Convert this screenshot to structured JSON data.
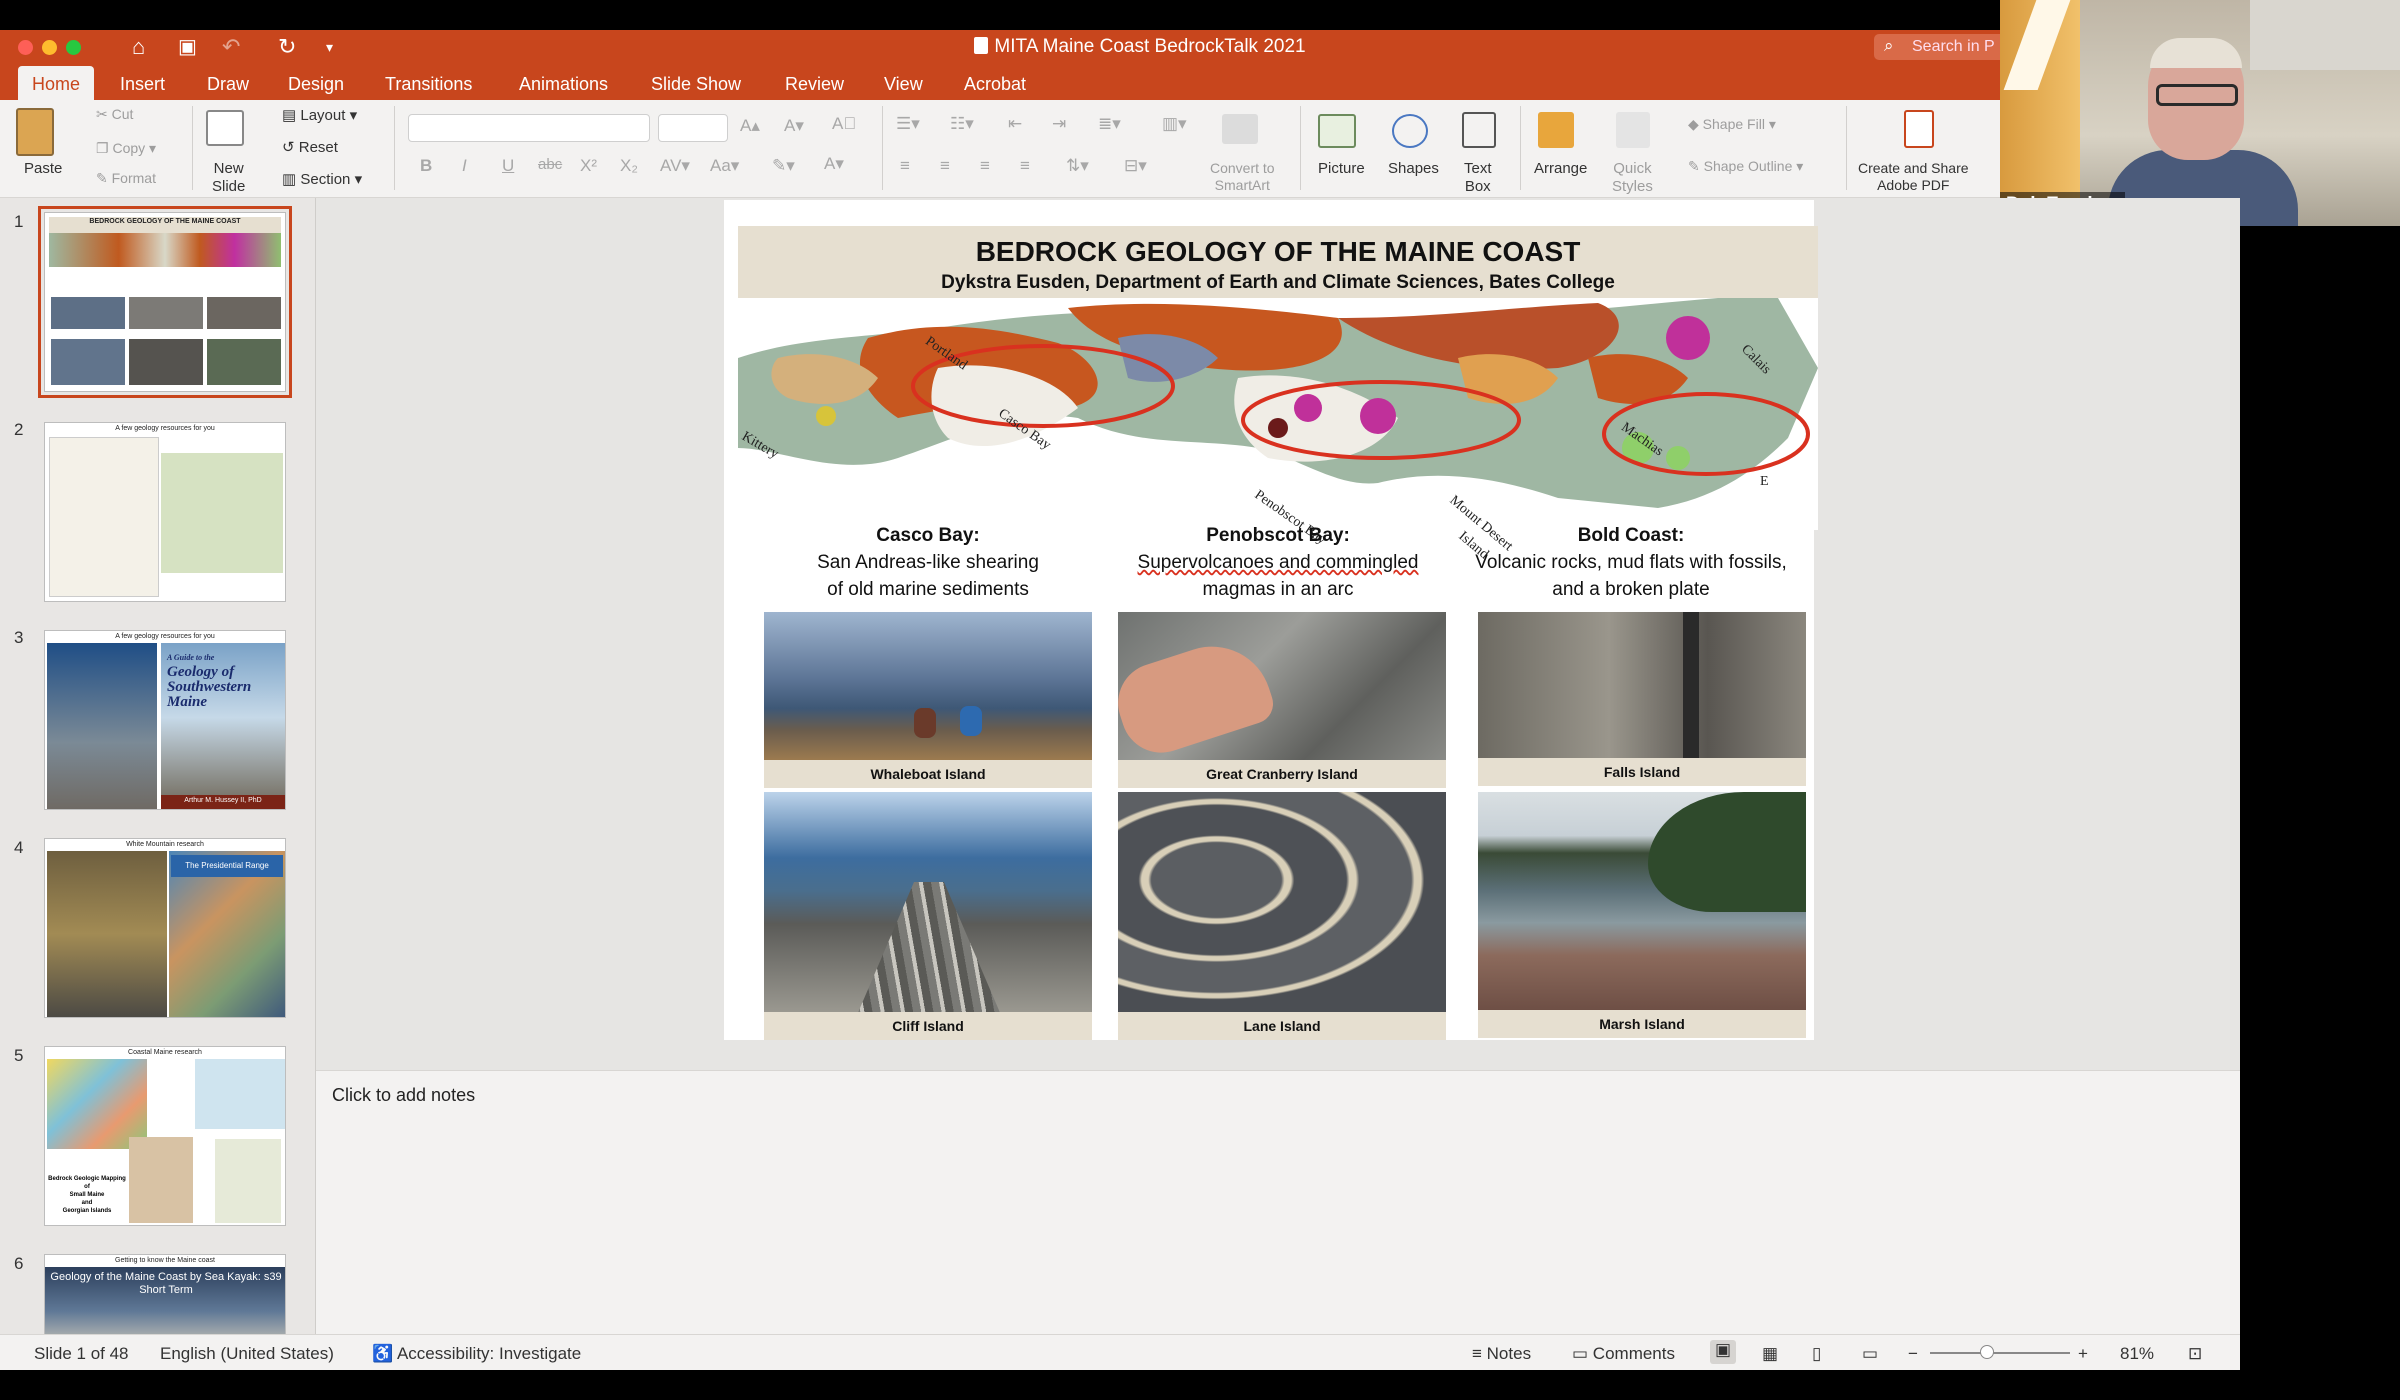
{
  "app": {
    "document_title": "MITA Maine Coast BedrockTalk 2021",
    "search_placeholder": "Search in P"
  },
  "tabs": [
    "Home",
    "Insert",
    "Draw",
    "Design",
    "Transitions",
    "Animations",
    "Slide Show",
    "Review",
    "View",
    "Acrobat"
  ],
  "ribbon": {
    "paste": "Paste",
    "cut": "Cut",
    "copy": "Copy",
    "format": "Format",
    "new_slide": [
      "New",
      "Slide"
    ],
    "layout": "Layout",
    "reset": "Reset",
    "section": "Section",
    "convert_smartart": [
      "Convert to",
      "SmartArt"
    ],
    "picture": "Picture",
    "shapes": "Shapes",
    "text_box": [
      "Text",
      "Box"
    ],
    "arrange": "Arrange",
    "quick_styles": [
      "Quick",
      "Styles"
    ],
    "shape_fill": "Shape Fill",
    "shape_outline": "Shape Outline",
    "create_pdf": [
      "Create and Share",
      "Adobe PDF"
    ]
  },
  "webcam": {
    "participant_name": "Dyk Eusden"
  },
  "slide_pane": {
    "numbers": [
      "1",
      "2",
      "3",
      "4",
      "5",
      "6"
    ],
    "thumb1_title": "BEDROCK GEOLOGY OF THE MAINE COAST",
    "thumb2_title": "A few geology resources for you",
    "thumb3_title": "A few geology resources for you",
    "thumb3_book_title": [
      "A Guide to the",
      "Geology of",
      "Southwestern",
      "Maine"
    ],
    "thumb3_author": "Arthur M. Hussey II, PhD",
    "thumb4_title": "White Mountain research",
    "thumb4_book": "The Presidential Range",
    "thumb5_title": "Coastal Maine research",
    "thumb5_caption": [
      "Bedrock Geologic Mapping of",
      "Small Maine",
      "and",
      "Georgian Islands"
    ],
    "thumb6_title": "Getting to know the Maine coast",
    "thumb6_banner": "Geology of the Maine Coast by Sea Kayak: s39",
    "thumb6_sub": "Short Term"
  },
  "slide": {
    "title": "BEDROCK GEOLOGY OF THE MAINE COAST",
    "subtitle": "Dykstra Eusden, Department of Earth and Climate Sciences, Bates College",
    "map_labels": [
      "Kittery",
      "Portland",
      "Casco Bay",
      "Penobscot Bay",
      "Mount Desert",
      "Island",
      "Machias",
      "Calais",
      "E"
    ],
    "columns": [
      {
        "heading": "Casco Bay:",
        "lines": [
          "San Andreas-like shearing",
          "of old marine sediments"
        ],
        "captions": [
          "Whaleboat Island",
          "Cliff Island"
        ]
      },
      {
        "heading": "Penobscot Bay:",
        "lines": [
          "Supervolcanoes and commingled",
          "magmas in an arc"
        ],
        "captions": [
          "Great Cranberry Island",
          "Lane Island"
        ]
      },
      {
        "heading": "Bold Coast:",
        "lines": [
          "Volcanic rocks, mud flats with fossils,",
          "and a broken plate"
        ],
        "captions": [
          "Falls Island",
          "Marsh Island"
        ]
      }
    ]
  },
  "notes": {
    "placeholder": "Click to add notes"
  },
  "status": {
    "slide_count": "Slide 1 of 48",
    "language": "English (United States)",
    "accessibility": "Accessibility: Investigate",
    "notes": "Notes",
    "comments": "Comments",
    "zoom": "81%"
  },
  "colors": {
    "accent": "#c8461d",
    "ribbon_bg": "#f3f2f1",
    "caption_band": "#e6dfd0",
    "circle": "#d9311f"
  }
}
